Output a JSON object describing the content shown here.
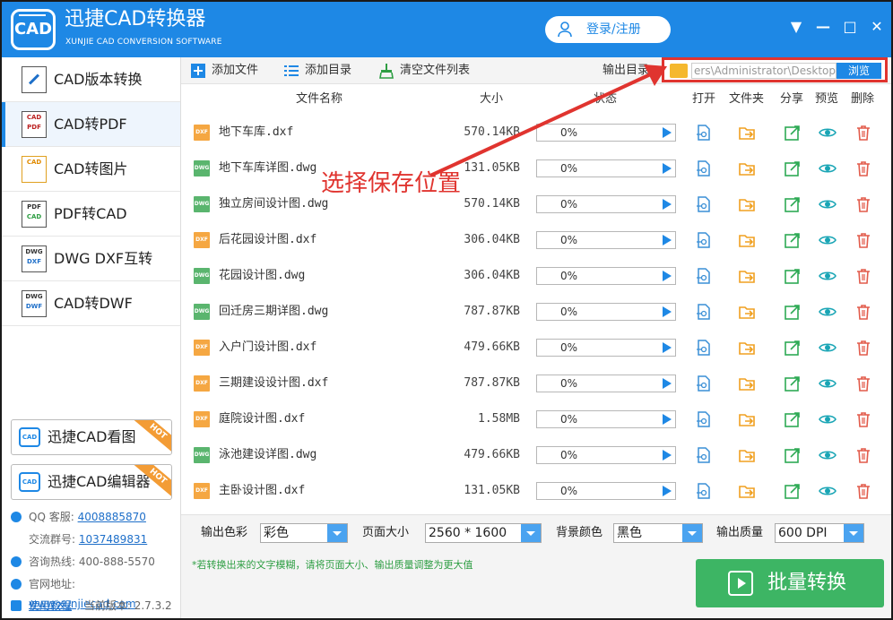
{
  "app": {
    "title": "迅捷CAD转换器",
    "subtitle": "XUNJIE CAD CONVERSION SOFTWARE",
    "logo_text": "CAD",
    "login_label": "登录/注册"
  },
  "window_controls": [
    "▼",
    "—",
    "□",
    "✕"
  ],
  "sidebar": {
    "items": [
      {
        "label": "CAD版本转换",
        "icon": "version-convert-icon"
      },
      {
        "label": "CAD转PDF",
        "icon": "cad-to-pdf-icon"
      },
      {
        "label": "CAD转图片",
        "icon": "cad-to-image-icon"
      },
      {
        "label": "PDF转CAD",
        "icon": "pdf-to-cad-icon"
      },
      {
        "label": "DWG DXF互转",
        "icon": "dwg-dxf-icon"
      },
      {
        "label": "CAD转DWF",
        "icon": "cad-to-dwf-icon"
      }
    ],
    "active_index": 1,
    "promos": [
      {
        "label": "迅捷CAD看图",
        "badge": "HOT"
      },
      {
        "label": "迅捷CAD编辑器",
        "badge": "HOT"
      }
    ],
    "contacts": [
      {
        "label": "QQ 客服:",
        "value": "4008885870"
      },
      {
        "label": "交流群号:",
        "value": "1037489831"
      },
      {
        "label": "咨询热线:",
        "value": "400-888-5570"
      },
      {
        "label": "官网地址:",
        "value": "www.xunjiecad.com"
      },
      {
        "label": "使用教程",
        "value": "当前版本:  2.7.3.2"
      }
    ]
  },
  "toolbar": {
    "add_file": "添加文件",
    "add_dir": "添加目录",
    "clear_list": "清空文件列表",
    "output_label": "输出目录:",
    "output_path": "C:\\Users\\Administrator\\Desktop",
    "browse": "浏览"
  },
  "table": {
    "headers": {
      "name": "文件名称",
      "size": "大小",
      "status": "状态",
      "open": "打开",
      "folder": "文件夹",
      "share": "分享",
      "preview": "预览",
      "delete": "删除"
    },
    "rows": [
      {
        "type": "DXF",
        "name": "地下车库.dxf",
        "size": "570.14KB",
        "progress": "0%"
      },
      {
        "type": "DWG",
        "name": "地下车库详图.dwg",
        "size": "131.05KB",
        "progress": "0%"
      },
      {
        "type": "DWG",
        "name": "独立房间设计图.dwg",
        "size": "570.14KB",
        "progress": "0%"
      },
      {
        "type": "DXF",
        "name": "后花园设计图.dxf",
        "size": "306.04KB",
        "progress": "0%"
      },
      {
        "type": "DWG",
        "name": "花园设计图.dwg",
        "size": "306.04KB",
        "progress": "0%"
      },
      {
        "type": "DWG",
        "name": "回迁房三期详图.dwg",
        "size": "787.87KB",
        "progress": "0%"
      },
      {
        "type": "DXF",
        "name": "入户门设计图.dxf",
        "size": "479.66KB",
        "progress": "0%"
      },
      {
        "type": "DXF",
        "name": "三期建设设计图.dxf",
        "size": "787.87KB",
        "progress": "0%"
      },
      {
        "type": "DXF",
        "name": "庭院设计图.dxf",
        "size": "1.58MB",
        "progress": "0%"
      },
      {
        "type": "DWG",
        "name": "泳池建设详图.dwg",
        "size": "479.66KB",
        "progress": "0%"
      },
      {
        "type": "DXF",
        "name": "主卧设计图.dxf",
        "size": "131.05KB",
        "progress": "0%"
      }
    ]
  },
  "options": {
    "color_label": "输出色彩",
    "color_value": "彩色",
    "page_label": "页面大小",
    "page_value": "2560 * 1600",
    "bg_label": "背景颜色",
    "bg_value": "黑色",
    "quality_label": "输出质量",
    "quality_value": "600 DPI"
  },
  "footer": {
    "tip": "*若转换出来的文字模糊，请将页面大小、输出质量调整为更大值",
    "convert_label": "批量转换"
  },
  "annotation": {
    "text": "选择保存位置",
    "color": "#e0342f"
  },
  "colors": {
    "accent": "#1e88e5",
    "convert": "#3db564",
    "dxf": "#f5a742",
    "dwg": "#5ab56e"
  }
}
